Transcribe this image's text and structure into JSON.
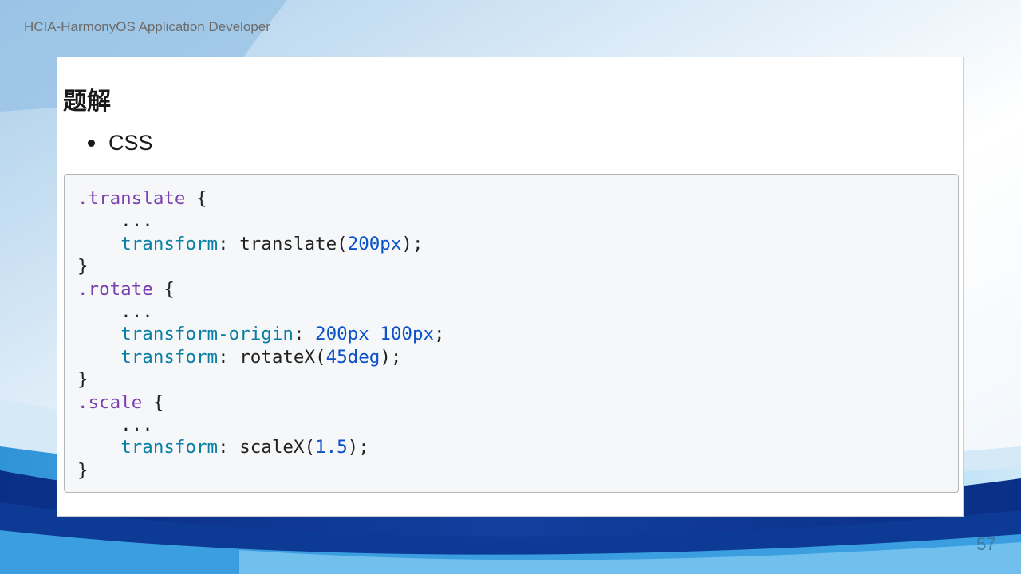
{
  "header": {
    "course_title": "HCIA-HarmonyOS Application Developer"
  },
  "slide": {
    "heading": "题解",
    "bullet": "CSS",
    "code_lines": [
      [
        {
          "t": ".translate",
          "c": "sel"
        },
        {
          "t": " {",
          "c": "plain"
        }
      ],
      [
        {
          "t": "    ...",
          "c": "plain"
        }
      ],
      [
        {
          "t": "    ",
          "c": "plain"
        },
        {
          "t": "transform",
          "c": "prop"
        },
        {
          "t": ": translate(",
          "c": "plain"
        },
        {
          "t": "200px",
          "c": "num"
        },
        {
          "t": ");",
          "c": "plain"
        }
      ],
      [
        {
          "t": "}",
          "c": "plain"
        }
      ],
      [
        {
          "t": ".rotate",
          "c": "sel"
        },
        {
          "t": " {",
          "c": "plain"
        }
      ],
      [
        {
          "t": "    ...",
          "c": "plain"
        }
      ],
      [
        {
          "t": "    ",
          "c": "plain"
        },
        {
          "t": "transform-origin",
          "c": "prop"
        },
        {
          "t": ": ",
          "c": "plain"
        },
        {
          "t": "200px",
          "c": "num"
        },
        {
          "t": " ",
          "c": "plain"
        },
        {
          "t": "100px",
          "c": "num"
        },
        {
          "t": ";",
          "c": "plain"
        }
      ],
      [
        {
          "t": "    ",
          "c": "plain"
        },
        {
          "t": "transform",
          "c": "prop"
        },
        {
          "t": ": rotateX(",
          "c": "plain"
        },
        {
          "t": "45deg",
          "c": "num"
        },
        {
          "t": ");",
          "c": "plain"
        }
      ],
      [
        {
          "t": "}",
          "c": "plain"
        }
      ],
      [
        {
          "t": ".scale",
          "c": "sel"
        },
        {
          "t": " {",
          "c": "plain"
        }
      ],
      [
        {
          "t": "    ...",
          "c": "plain"
        }
      ],
      [
        {
          "t": "    ",
          "c": "plain"
        },
        {
          "t": "transform",
          "c": "prop"
        },
        {
          "t": ": scaleX(",
          "c": "plain"
        },
        {
          "t": "1.5",
          "c": "num"
        },
        {
          "t": ");",
          "c": "plain"
        }
      ],
      [
        {
          "t": "}",
          "c": "plain"
        }
      ]
    ]
  },
  "footer": {
    "page_number": "57"
  },
  "colors": {
    "selector": "#7a3fb0",
    "property": "#0a7fa5",
    "number": "#0b52c7",
    "plain": "#222222",
    "accent_blue": "#1566b8"
  }
}
